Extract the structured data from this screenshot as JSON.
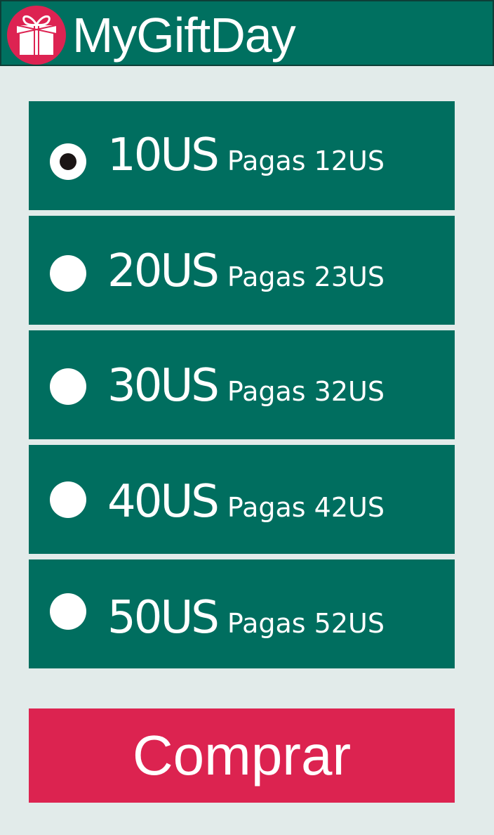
{
  "header": {
    "title": "MyGiftDay",
    "logo_icon": "gift-icon"
  },
  "options": [
    {
      "amount": "10US",
      "pay": "Pagas 12US",
      "selected": true
    },
    {
      "amount": "20US",
      "pay": "Pagas 23US",
      "selected": false
    },
    {
      "amount": "30US",
      "pay": "Pagas 32US",
      "selected": false
    },
    {
      "amount": "40US",
      "pay": "Pagas 42US",
      "selected": false
    },
    {
      "amount": "50US",
      "pay": "Pagas 52US",
      "selected": false
    }
  ],
  "buy_button": {
    "label": "Comprar"
  },
  "colors": {
    "header": "#007060",
    "option": "#006e5f",
    "accent": "#dc2350",
    "background": "#e2ebea"
  }
}
